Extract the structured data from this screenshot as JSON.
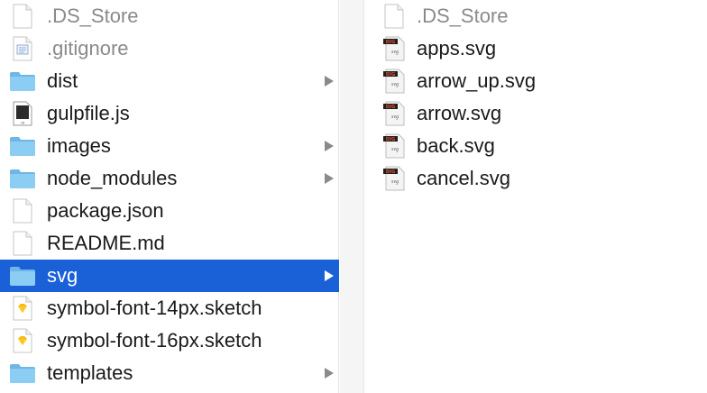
{
  "left_column": {
    "items": [
      {
        "label": ".DS_Store",
        "icon": "blank-file-icon",
        "dimmed": true,
        "folder": false
      },
      {
        "label": ".gitignore",
        "icon": "text-file-icon",
        "dimmed": true,
        "folder": false
      },
      {
        "label": "dist",
        "icon": "folder-icon",
        "dimmed": false,
        "folder": true
      },
      {
        "label": "gulpfile.js",
        "icon": "js-file-icon",
        "dimmed": false,
        "folder": false
      },
      {
        "label": "images",
        "icon": "folder-icon",
        "dimmed": false,
        "folder": true
      },
      {
        "label": "node_modules",
        "icon": "folder-icon",
        "dimmed": false,
        "folder": true
      },
      {
        "label": "package.json",
        "icon": "blank-file-icon",
        "dimmed": false,
        "folder": false
      },
      {
        "label": "README.md",
        "icon": "blank-file-icon",
        "dimmed": false,
        "folder": false
      },
      {
        "label": "svg",
        "icon": "folder-icon",
        "dimmed": false,
        "folder": true,
        "selected": true
      },
      {
        "label": "symbol-font-14px.sketch",
        "icon": "sketch-file-icon",
        "dimmed": false,
        "folder": false
      },
      {
        "label": "symbol-font-16px.sketch",
        "icon": "sketch-file-icon",
        "dimmed": false,
        "folder": false
      },
      {
        "label": "templates",
        "icon": "folder-icon",
        "dimmed": false,
        "folder": true
      }
    ]
  },
  "right_column": {
    "items": [
      {
        "label": ".DS_Store",
        "icon": "blank-file-icon",
        "dimmed": true
      },
      {
        "label": "apps.svg",
        "icon": "svg-file-icon",
        "dimmed": false
      },
      {
        "label": "arrow_up.svg",
        "icon": "svg-file-icon",
        "dimmed": false
      },
      {
        "label": "arrow.svg",
        "icon": "svg-file-icon",
        "dimmed": false
      },
      {
        "label": "back.svg",
        "icon": "svg-file-icon",
        "dimmed": false
      },
      {
        "label": "cancel.svg",
        "icon": "svg-file-icon",
        "dimmed": false
      }
    ]
  },
  "icon_badges": {
    "svg": "SVG",
    "svg_script": "svg",
    "js": "JS"
  },
  "colors": {
    "selection": "#1a61d8",
    "folder": "#8ccdf3",
    "folder_tab": "#6fb6e6",
    "dimmed_text": "#8a8a8a",
    "disclosure_arrow": "#8a8a8a",
    "sketch": "#f7b500"
  }
}
